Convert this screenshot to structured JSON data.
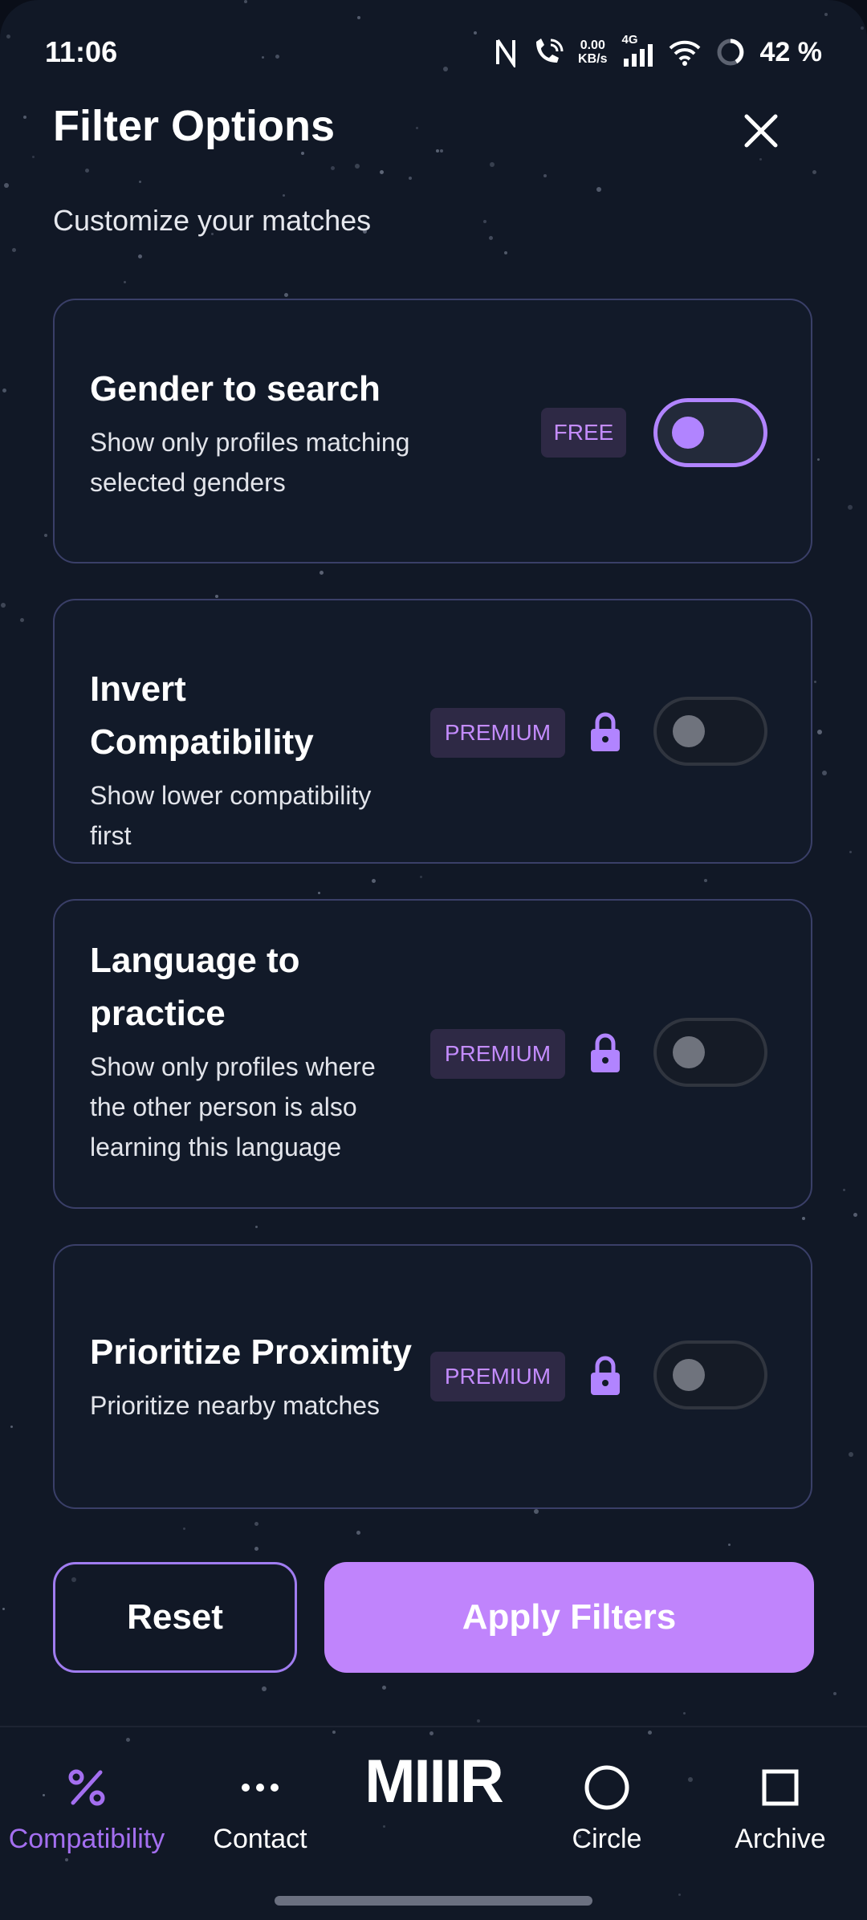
{
  "status_bar": {
    "time": "11:06",
    "net_speed_value": "0.00",
    "net_speed_unit": "KB/s",
    "network_type": "4G",
    "battery": "42 %"
  },
  "header": {
    "title": "Filter Options",
    "subtitle": "Customize your matches"
  },
  "filters": [
    {
      "title": "Gender to search",
      "description": "Show only profiles matching selected genders",
      "badge": "FREE",
      "locked": false,
      "enabled": true
    },
    {
      "title": "Invert Compatibility",
      "description": "Show lower compatibility first",
      "badge": "PREMIUM",
      "locked": true,
      "enabled": false
    },
    {
      "title": "Language to practice",
      "description": "Show only profiles where the other person is also learning this language",
      "badge": "PREMIUM",
      "locked": true,
      "enabled": false
    },
    {
      "title": "Prioritize Proximity",
      "description": "Prioritize nearby matches",
      "badge": "PREMIUM",
      "locked": true,
      "enabled": false
    }
  ],
  "actions": {
    "reset_label": "Reset",
    "apply_label": "Apply Filters"
  },
  "bottom_nav": {
    "brand": "MIIIR",
    "items": [
      {
        "label": "Compatibility",
        "icon": "percent-icon",
        "active": true
      },
      {
        "label": "Contact",
        "icon": "more-dots-icon",
        "active": false
      },
      {
        "label": "Circle",
        "icon": "circle-icon",
        "active": false
      },
      {
        "label": "Archive",
        "icon": "square-icon",
        "active": false
      }
    ]
  },
  "colors": {
    "background": "#111826",
    "accent": "#c084fc",
    "card_border": "#3a3f68",
    "badge_bg": "#2e2945",
    "badge_text": "#c48cff"
  }
}
